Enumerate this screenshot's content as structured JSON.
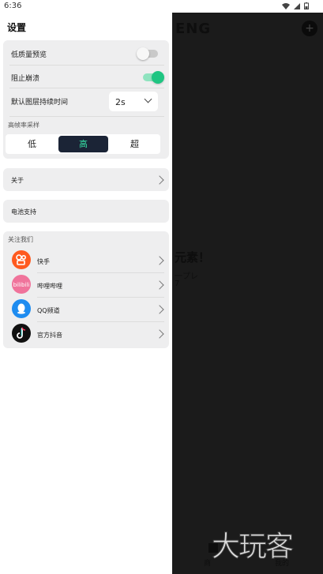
{
  "status_bar": {
    "time": "6:36"
  },
  "background": {
    "title_fragment": "ENG",
    "headline_fragment": "元素！",
    "line1": "一プレ",
    "line2": "7",
    "nav_left": "商",
    "nav_right": "我的"
  },
  "watermark": "大玩客",
  "settings": {
    "title": "设置",
    "low_quality_preview": {
      "label": "低质量预览",
      "on": false
    },
    "prevent_crash": {
      "label": "阻止崩溃",
      "on": true
    },
    "default_layer_duration": {
      "label": "默认图层持续时间",
      "value": "2s"
    },
    "frame_rate": {
      "label": "高帧率采样",
      "options": [
        "低",
        "高",
        "超"
      ],
      "selected": "高"
    }
  },
  "about": {
    "label": "关于"
  },
  "power_support": {
    "label": "电池支持"
  },
  "follow_us": {
    "label": "关注我们",
    "items": [
      {
        "name": "快手",
        "icon": "kuaishou-icon",
        "color": "#ff5a1f"
      },
      {
        "name": "哔哩哔哩",
        "icon": "bilibili-icon",
        "color": "#f0739b"
      },
      {
        "name": "QQ频道",
        "icon": "qq-icon",
        "color": "#1e8cf0"
      },
      {
        "name": "官方抖音",
        "icon": "douyin-icon",
        "color": "#111111"
      }
    ]
  },
  "colors": {
    "accent": "#1fc582",
    "segment_active_bg": "#1b2436",
    "segment_active_text": "#35e0a3"
  }
}
